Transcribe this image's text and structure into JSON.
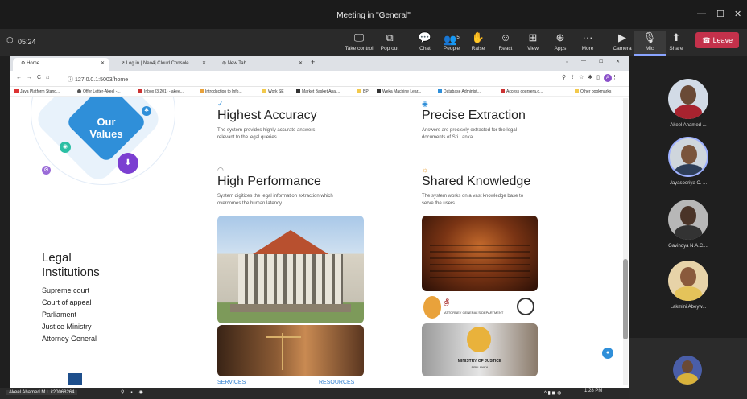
{
  "window": {
    "title": "Meeting in \"General\""
  },
  "meeting": {
    "timer": "05:24",
    "tools": [
      {
        "label": "Take control",
        "icon": "take-control-icon"
      },
      {
        "label": "Pop out",
        "icon": "pop-out-icon"
      },
      {
        "label": "Chat",
        "icon": "chat-icon"
      },
      {
        "label": "People",
        "icon": "people-icon",
        "badge": "5"
      },
      {
        "label": "Raise",
        "icon": "raise-hand-icon"
      },
      {
        "label": "React",
        "icon": "react-icon"
      },
      {
        "label": "View",
        "icon": "view-icon"
      },
      {
        "label": "Apps",
        "icon": "apps-icon"
      },
      {
        "label": "More",
        "icon": "more-icon"
      },
      {
        "label": "Camera",
        "icon": "camera-off-icon"
      },
      {
        "label": "Mic",
        "icon": "mic-icon"
      },
      {
        "label": "Share",
        "icon": "share-icon"
      }
    ],
    "leave": "Leave"
  },
  "browser": {
    "tabs": [
      {
        "label": "Home"
      },
      {
        "label": "Log in | Neo4j Cloud Console"
      },
      {
        "label": "New Tab"
      }
    ],
    "url": "127.0.0.1:5003/home",
    "profile": "A",
    "bookmarks": [
      "Java Platform Stand...",
      "Offer Letter-Akeel -...",
      "Inbox (3,201) - akee...",
      "Introduction to Info...",
      "Work SE",
      "Market Basket Anal...",
      "BP",
      "Weka Machine Lear...",
      "Database Administ...",
      "Access coursera.o...",
      "Other bookmarks"
    ]
  },
  "page": {
    "values_title": "Our Values",
    "legal": {
      "heading": "Legal Institutions",
      "items": [
        "Supreme court",
        "Court of appeal",
        "Parliament",
        "Justice Ministry",
        "Attorney General"
      ]
    },
    "features": [
      {
        "title": "Highest Accuracy",
        "desc": "The system provides highly accurate answers relevant to the legal queries."
      },
      {
        "title": "Precise Extraction",
        "desc": "Answers are precisely extracted for the legal documents of Sri Lanka"
      },
      {
        "title": "High Performance",
        "desc": "System digitizes the legal information extraction which overcomes the human latency."
      },
      {
        "title": "Shared Knowledge",
        "desc": "The system works on a vast knowledge base to serve the users."
      }
    ],
    "links": {
      "services": "SERVICES",
      "resources": "RESOURCES"
    },
    "ag_sign": "ATTORNEY GENERAL'S DEPARTMENT",
    "moj_sign": "MINISTRY OF JUSTICE",
    "moj_sub": "SRI LANKA"
  },
  "participants": [
    {
      "name": "Akeel Ahamed ..."
    },
    {
      "name": "Jayasooriya C. ..."
    },
    {
      "name": "Gavindya N.A.C...."
    },
    {
      "name": "Lakmini Abeyw..."
    }
  ],
  "taskbar": {
    "user": "Akeel Ahamed M.L it20068264",
    "time": "1:28 PM"
  }
}
